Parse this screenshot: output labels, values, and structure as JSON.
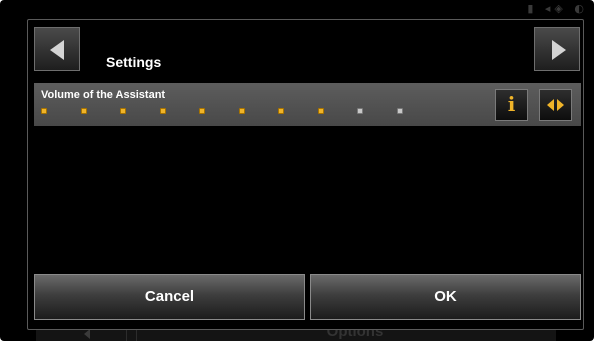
{
  "status_bar": {
    "icons": [
      "battery-icon",
      "signal-icon",
      "gps-icon"
    ],
    "glyphs": "▮ ◂◈ ◐"
  },
  "background_screen": {
    "options_label": "Options"
  },
  "header": {
    "title": "Settings",
    "prev_icon": "left-arrow-icon",
    "next_icon": "right-arrow-icon"
  },
  "setting": {
    "label": "Volume of the Assistant",
    "volume_level": 8,
    "volume_max": 10,
    "info_icon": "info-icon",
    "info_glyph": "i",
    "adjust_icon": "left-right-arrows-icon"
  },
  "buttons": {
    "cancel": "Cancel",
    "ok": "OK"
  },
  "colors": {
    "accent": "#f0b429",
    "row_background": "#555555",
    "inactive_dot": "#c8c8c8"
  }
}
